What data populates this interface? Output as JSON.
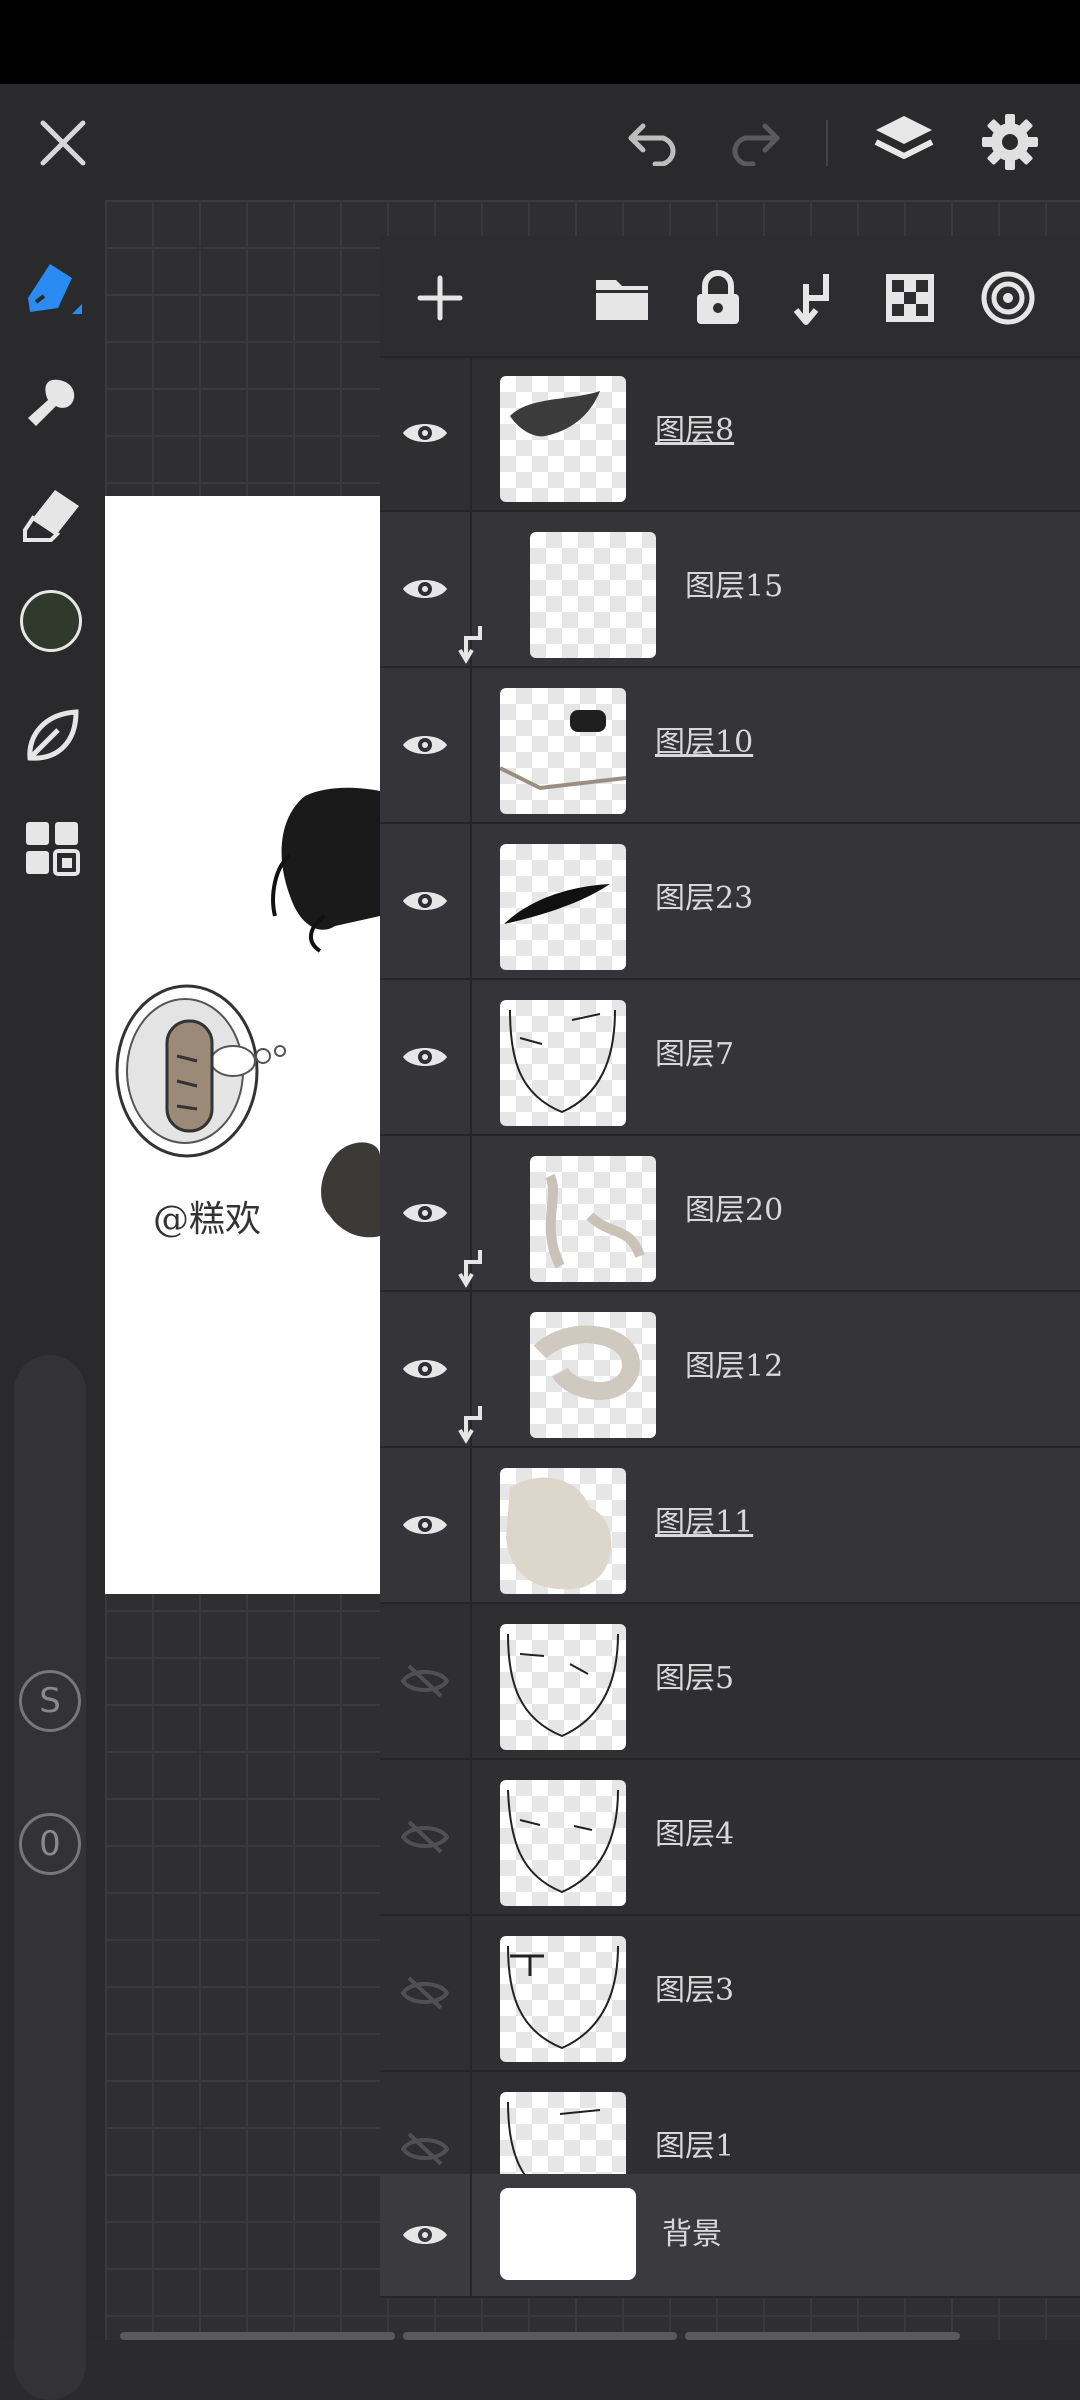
{
  "toolbar": {
    "close": "close-icon",
    "undo": "undo-icon",
    "redo": "redo-icon",
    "layers": "layers-icon",
    "settings": "gear-icon"
  },
  "tools": {
    "brush": "pen-icon",
    "smudge": "smudge-icon",
    "eraser": "eraser-icon",
    "color": "#2f3a2c",
    "stabilizer": "leaf-icon",
    "gallery": "grid-icon",
    "size_label": "S",
    "opacity_label": "0"
  },
  "canvas": {
    "signature": "@糕欢"
  },
  "layer_toolbar": {
    "add": "plus-icon",
    "folder": "folder-icon",
    "lock": "lock-icon",
    "merge": "merge-down-icon",
    "transparency": "checker-icon",
    "mask": "target-icon"
  },
  "layers": [
    {
      "name": "图层8",
      "visible": true,
      "clipped": false,
      "underline": true
    },
    {
      "name": "图层15",
      "visible": true,
      "clipped": true,
      "underline": false
    },
    {
      "name": "图层10",
      "visible": true,
      "clipped": false,
      "underline": true
    },
    {
      "name": "图层23",
      "visible": true,
      "clipped": false,
      "underline": false
    },
    {
      "name": "图层7",
      "visible": true,
      "clipped": false,
      "underline": false
    },
    {
      "name": "图层20",
      "visible": true,
      "clipped": true,
      "underline": false
    },
    {
      "name": "图层12",
      "visible": true,
      "clipped": true,
      "underline": false
    },
    {
      "name": "图层11",
      "visible": true,
      "clipped": false,
      "underline": true
    },
    {
      "name": "图层5",
      "visible": false,
      "clipped": false,
      "underline": false
    },
    {
      "name": "图层4",
      "visible": false,
      "clipped": false,
      "underline": false
    },
    {
      "name": "图层3",
      "visible": false,
      "clipped": false,
      "underline": false
    },
    {
      "name": "图层1",
      "visible": false,
      "clipped": false,
      "underline": false
    }
  ],
  "background_layer": {
    "name": "背景",
    "visible": true
  }
}
